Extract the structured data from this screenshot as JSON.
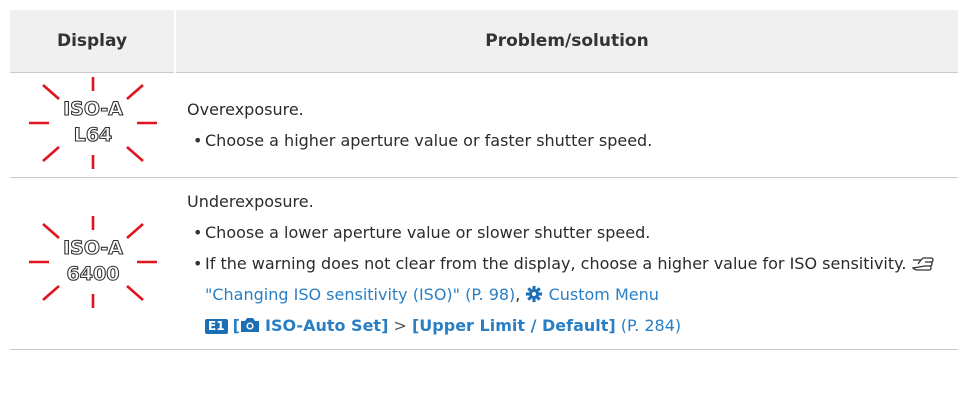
{
  "headers": {
    "display": "Display",
    "problem": "Problem/solution"
  },
  "rows": [
    {
      "display": {
        "line1": "ISO-A",
        "line2": "L64"
      },
      "lead": "Overexposure.",
      "bullets": [
        "Choose a higher aperture value or faster shutter speed."
      ]
    },
    {
      "display": {
        "line1": "ISO-A",
        "line2": "6400"
      },
      "lead": "Underexposure.",
      "bullets": [
        "Choose a lower aperture value or slower shutter speed.",
        "If the warning does not clear from the display, choose a higher value for ISO sensitivity."
      ],
      "ref_icon": "pointing-hand-icon",
      "link_text": "\"Changing ISO sensitivity (ISO)\" (P. 98)",
      "comma": ",",
      "menu_icon": "gear-icon",
      "menu_text": "Custom Menu",
      "tab_label": "E1",
      "bracket_open": "[",
      "camera_icon": "camera-icon",
      "menu_item": "ISO-Auto Set]",
      "gt": ">",
      "submenu": "[Upper Limit / Default]",
      "page_ref": "(P. 284)"
    }
  ],
  "colors": {
    "flash": "#e0141e",
    "link": "#2a7fc4",
    "header_bg": "#f0f0f0",
    "tab_bg": "#1d6fb5"
  }
}
